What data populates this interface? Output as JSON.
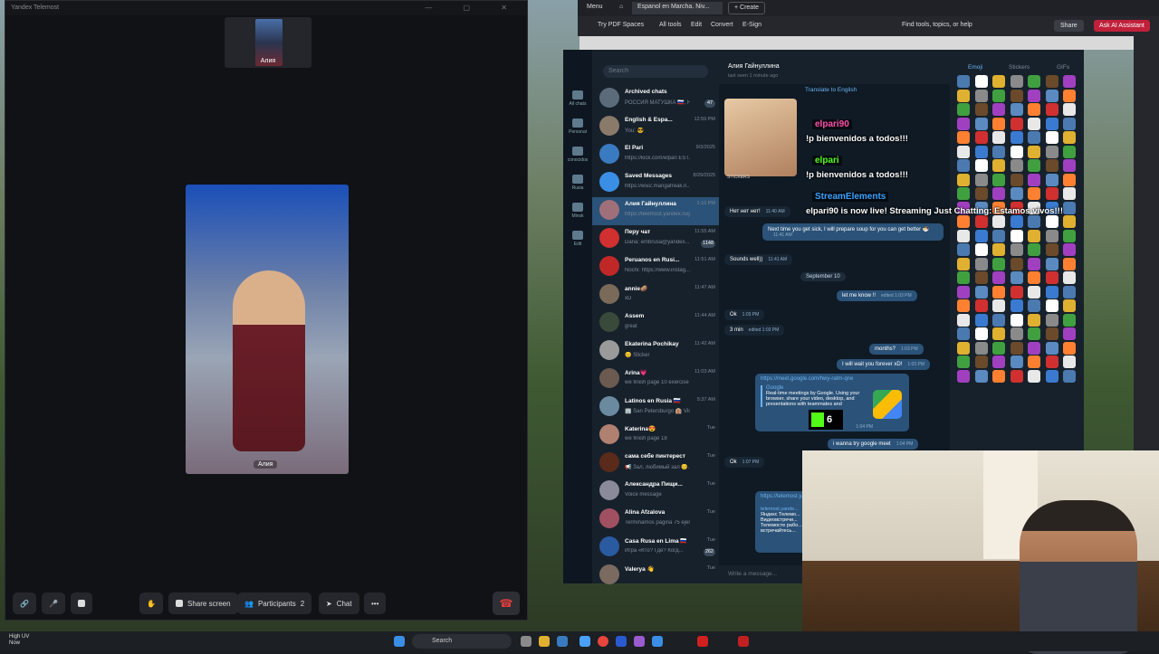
{
  "telemost": {
    "window_title": "Yandex Telemost",
    "thumb_name": "Алия",
    "main_name": "Алия",
    "controls": {
      "share_screen": "Share screen",
      "participants": "Participants",
      "participants_count": "2",
      "chat": "Chat",
      "more": "•••"
    }
  },
  "acrobat": {
    "menu": "Menu",
    "tab_title": "Espanol en Marcha. Niv...",
    "create": "+ Create",
    "try_pdf_spaces": "Try PDF Spaces",
    "tools": [
      "All tools",
      "Edit",
      "Convert",
      "E-Sign"
    ],
    "find": "Find tools, topics, or help",
    "share": "Share",
    "ai_assistant": "Ask AI Assistant"
  },
  "telegram": {
    "search_placeholder": "Search",
    "rail": [
      "All chats",
      "Personal",
      "conocidos",
      "Rusia",
      "Minsk",
      "Edit"
    ],
    "chats": [
      {
        "name": "Archived chats",
        "preview": "РОССИЯ МАТУШКА 🇷🇺, Н...",
        "time": "",
        "badge": "47",
        "color": "#5b6b7a"
      },
      {
        "name": "English & Espa...",
        "preview": "You: 😎",
        "time": "12:59 PM",
        "badge": "",
        "color": "#8a7a6a"
      },
      {
        "name": "El Pari",
        "preview": "https://kick.com/elpari EST...",
        "time": "9/3/2025",
        "badge": "",
        "color": "#3a7ac0"
      },
      {
        "name": "Saved Messages",
        "preview": "https://ww2.mangafreak.n...",
        "time": "8/29/2025",
        "badge": "",
        "color": "#3a8ee6"
      },
      {
        "name": "Алия Гайнуллина",
        "preview": "https://telemost.yandex.ru/j/89...",
        "time": "1:10 PM",
        "badge": "",
        "color": "#a0707a"
      },
      {
        "name": "Перу чат",
        "preview": "Daria: embrusa@yandex...",
        "time": "11:55 AM",
        "badge": "1148",
        "color": "#d03030"
      },
      {
        "name": "Peruanos en Rusi...",
        "preview": "Nochi: https://www.instag...",
        "time": "11:51 AM",
        "badge": "",
        "color": "#c02828"
      },
      {
        "name": "annie🥔",
        "preview": "xD",
        "time": "11:47 AM",
        "badge": "",
        "color": "#7a6a5a"
      },
      {
        "name": "Assem",
        "preview": "great",
        "time": "11:44 AM",
        "badge": "",
        "color": "#3a4a3a"
      },
      {
        "name": "Ekaterina Pochikay",
        "preview": "😊 Sticker",
        "time": "11:42 AM",
        "badge": "",
        "color": "#9a9a9a"
      },
      {
        "name": "Arina💗",
        "preview": "we finish page 10 exercise C",
        "time": "11:03 AM",
        "badge": "",
        "color": "#6a5a50"
      },
      {
        "name": "Latinos en Rusia 🇷🇺",
        "preview": "🏢 San Petersburgo 🏨 Visa y...",
        "time": "5:37 AM",
        "badge": "",
        "color": "#6a8aa0"
      },
      {
        "name": "Katerina😍",
        "preview": "we finish page 18",
        "time": "Tue",
        "badge": "",
        "color": "#b08070"
      },
      {
        "name": "сама себе пинтерест",
        "preview": "📢 Зал, любимый зал 😊...",
        "time": "Tue",
        "badge": "",
        "color": "#5a2a1a"
      },
      {
        "name": "Александра Пищи...",
        "preview": "Voice message",
        "time": "Tue",
        "badge": "",
        "color": "#8a8a9a"
      },
      {
        "name": "Alina Afzalova",
        "preview": "Terminamos página 75 ejercicio...",
        "time": "Tue",
        "badge": "",
        "color": "#a05060"
      },
      {
        "name": "Casa Rusa en Lima 🇷🇺",
        "preview": "Игра «Кто? Где? Когд...",
        "time": "Tue",
        "badge": "262",
        "color": "#2a5aa0"
      },
      {
        "name": "Valerya 👋",
        "preview": "",
        "time": "Tue",
        "badge": "",
        "color": "#7a6a60"
      }
    ],
    "conversation": {
      "title": "Алия Гайнуллина",
      "status": "last seen 1 minute ago",
      "translate": "Translate to English",
      "stickers_label": "STICKERS",
      "messages": [
        {
          "text": "Нет нет нет!",
          "time": "11:40 AM",
          "dir": "in"
        },
        {
          "text": "Next time you get sick, I will prepare soup for you can get better 🍜",
          "time": "11:41 AM",
          "dir": "out"
        },
        {
          "text": "Sounds well))",
          "time": "11:41 AM",
          "dir": "in"
        },
        {
          "text": "let me know !!",
          "time": "edited 1:03 PM",
          "dir": "out"
        },
        {
          "text": "Ok",
          "time": "1:03 PM",
          "dir": "in"
        },
        {
          "text": "3 min",
          "time": "edited 1:03 PM",
          "dir": "in"
        },
        {
          "text": "months?",
          "time": "1:03 PM",
          "dir": "out"
        },
        {
          "text": "I will wait you forever xD!",
          "time": "1:03 PM",
          "dir": "out"
        },
        {
          "text": "i wanna try google meet",
          "time": "1:04 PM",
          "dir": "out"
        },
        {
          "text": "Ok",
          "time": "1:07 PM",
          "dir": "in"
        }
      ],
      "link_preview": {
        "url": "https://meet.google.com/hwy-ratm-qrw",
        "site": "Google",
        "desc": "Real-time meetings by Google. Using your browser, share your video, desktop, and presentations with teammates and",
        "time": "1:04 PM"
      },
      "telemost_preview": {
        "url": "https://telemost.y...",
        "lines": [
          "telemost.yande...",
          "Яндекс Телемо...",
          "Видеовстречи...",
          "Телемосте рабо...",
          "встречайтесь..."
        ]
      },
      "date_separator": "September 10",
      "write_placeholder": "Write a message..."
    },
    "emoji_panel": {
      "tabs": [
        "Emoji",
        "Stickers",
        "GIFs"
      ]
    }
  },
  "stream_overlay": {
    "lines": [
      {
        "user": "elpari90",
        "msg": "!p bienvenidos a todos!!!",
        "color": "#ff4fa8"
      },
      {
        "user": "elpari",
        "msg": "!p bienvenidos a todos!!!",
        "color": "#53fc18"
      },
      {
        "user": "StreamElements",
        "msg": "elpari90 is now live! Streaming Just Chatting: Estamos vivos!!!",
        "color": "#3aa0ff"
      }
    ],
    "kick_count": "6"
  },
  "taskbar": {
    "weather_temp": "High UV",
    "weather_sub": "Now",
    "search": "Search"
  }
}
